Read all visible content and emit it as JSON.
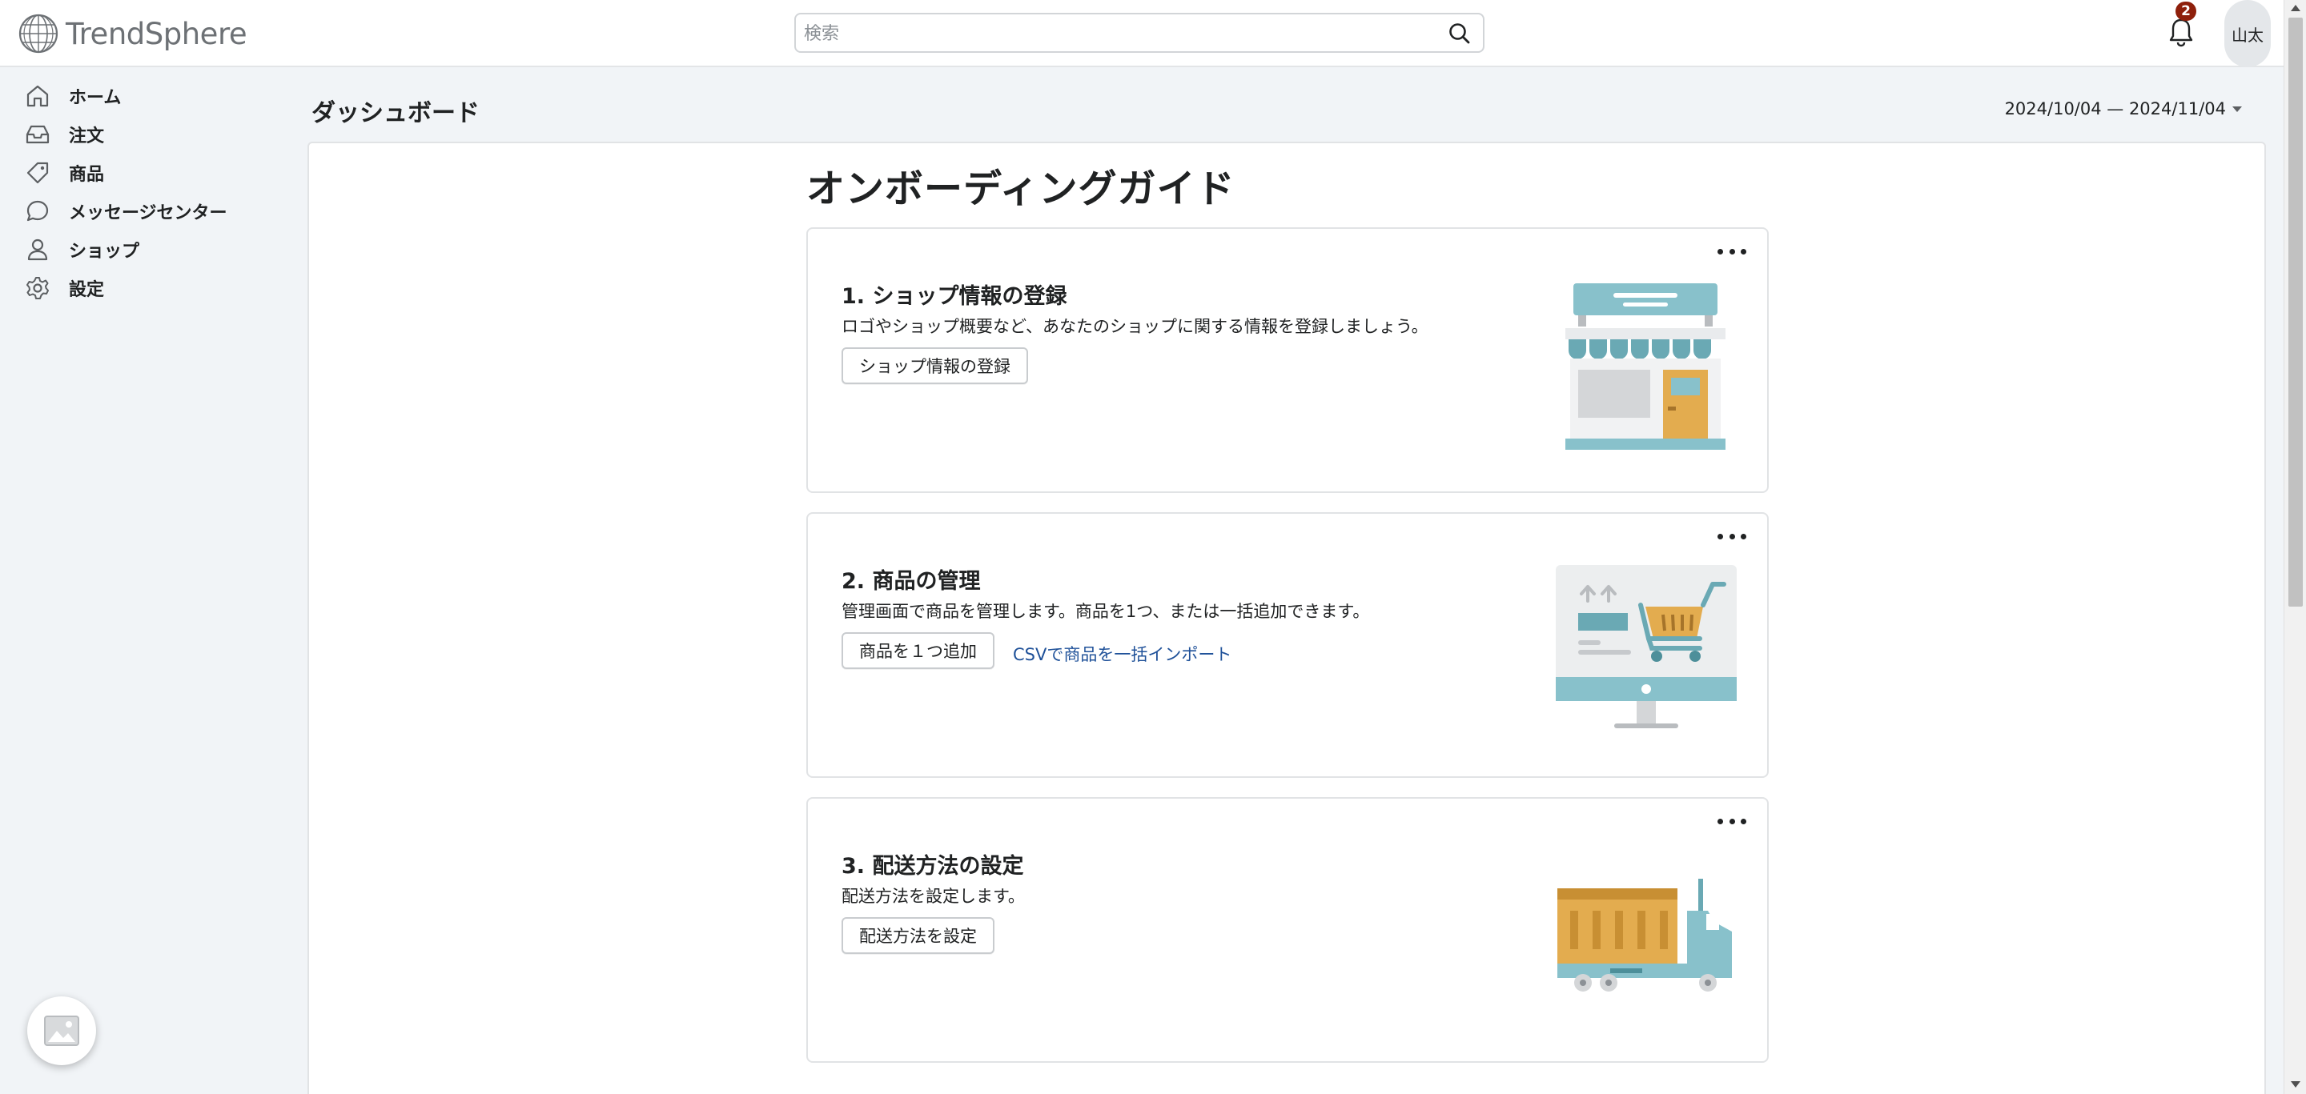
{
  "app": {
    "name": "TrendSphere"
  },
  "header": {
    "search_placeholder": "検索",
    "notification_count": "2",
    "user_name": "山太"
  },
  "sidebar": {
    "items": [
      {
        "label": "ホーム",
        "icon": "home-icon"
      },
      {
        "label": "注文",
        "icon": "inbox-icon"
      },
      {
        "label": "商品",
        "icon": "tag-icon"
      },
      {
        "label": "メッセージセンター",
        "icon": "chat-bubble-icon"
      },
      {
        "label": "ショップ",
        "icon": "person-icon"
      },
      {
        "label": "設定",
        "icon": "gear-icon"
      }
    ]
  },
  "main": {
    "page_title": "ダッシュボード",
    "date_range": "2024/10/04 — 2024/11/04",
    "guide_title": "オンボーディングガイド",
    "cards": [
      {
        "title": "1. ショップ情報の登録",
        "description": "ロゴやショップ概要など、あなたのショップに関する情報を登録しましょう。",
        "primary_button": "ショップ情報の登録",
        "illustration": "storefront-illustration"
      },
      {
        "title": "2. 商品の管理",
        "description": "管理画面で商品を管理します。商品を1つ、または一括追加できます。",
        "primary_button": "商品を１つ追加",
        "secondary_link": "CSVで商品を一括インポート",
        "illustration": "monitor-cart-illustration"
      },
      {
        "title": "3. 配送方法の設定",
        "description": "配送方法を設定します。",
        "primary_button": "配送方法を設定",
        "illustration": "delivery-truck-illustration"
      }
    ]
  },
  "colors": {
    "accent_teal": "#88c1cb",
    "accent_gold": "#e3ac4f",
    "badge_red": "#8e1f0b",
    "link_blue": "#1f5199"
  }
}
